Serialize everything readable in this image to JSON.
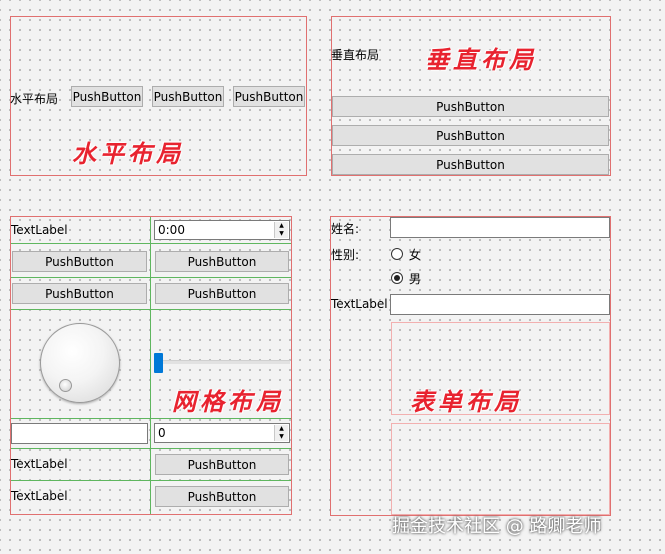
{
  "horizontal": {
    "label": "水平布局",
    "buttons": [
      "PushButton",
      "PushButton",
      "PushButton"
    ],
    "title": "水平布局"
  },
  "vertical": {
    "label": "垂直布局",
    "title": "垂直布局",
    "buttons": [
      "PushButton",
      "PushButton",
      "PushButton"
    ]
  },
  "grid": {
    "title": "网格布局",
    "row1_label": "TextLabel",
    "time_value": "0:00",
    "row2_buttons": [
      "PushButton",
      "PushButton"
    ],
    "row3_buttons": [
      "PushButton",
      "PushButton"
    ],
    "spin_value": "0",
    "row6_label": "TextLabel",
    "row6_button": "PushButton",
    "row7_label": "TextLabel",
    "row7_button": "PushButton",
    "slider_level": 0
  },
  "form": {
    "title": "表单布局",
    "name_label": "姓名:",
    "gender_label": "性别:",
    "female": "女",
    "male": "男",
    "textlabel": "TextLabel"
  },
  "watermark": "掘金技术社区 @ 路卿老师"
}
